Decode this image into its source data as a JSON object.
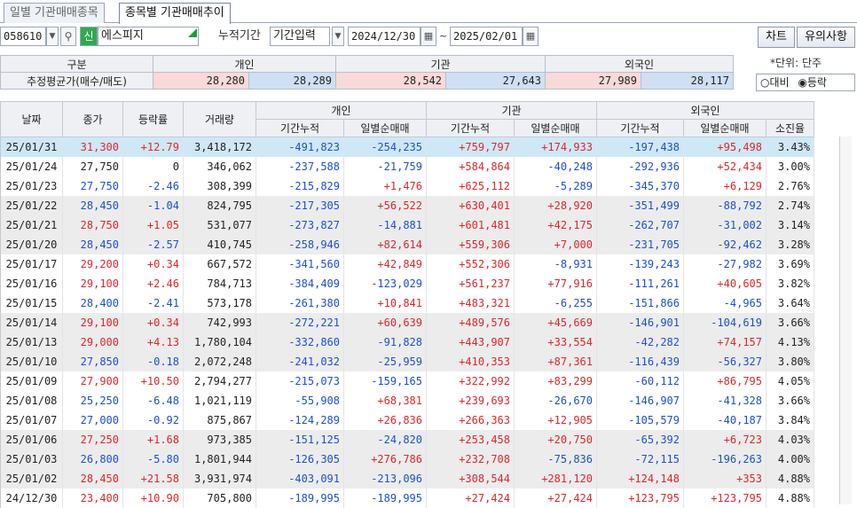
{
  "tabs": [
    {
      "label": "일별 기관매매종목",
      "active": false
    },
    {
      "label": "종목별 기관매매추이",
      "active": true
    }
  ],
  "toolbar": {
    "stock_code": "058610",
    "stock_badge": "신",
    "stock_name": "에스피지",
    "period_label": "누적기간",
    "period_mode": "기간입력",
    "start_date": "2024/12/30",
    "date_sep": "~",
    "end_date": "2025/02/01",
    "chart_button": "차트",
    "notice_button": "유의사항"
  },
  "summary": {
    "row1_label": "구분",
    "row2_label": "추정평균가(매수/매도)",
    "groups": [
      {
        "name": "개인",
        "buy": "28,280",
        "sell": "28,289"
      },
      {
        "name": "기관",
        "buy": "28,542",
        "sell": "27,643"
      },
      {
        "name": "외국인",
        "buy": "27,989",
        "sell": "28,117"
      }
    ],
    "unit": "*단위: 단주",
    "radio_compare": "대비",
    "radio_rate": "등락",
    "selected_radio": "rate"
  },
  "columns": {
    "date": "날짜",
    "close": "종가",
    "change": "등락률",
    "volume": "거래량",
    "individual": "개인",
    "institution": "기관",
    "foreign": "외국인",
    "cum": "기간누적",
    "daily": "일별순매매",
    "exhaust": "소진율"
  },
  "colors": {
    "up": "#e0262b",
    "down": "#1d4fd1",
    "selected_row": "#cfe8f6",
    "gray_row": "#ececec"
  },
  "rows": [
    {
      "date": "25/01/31",
      "close": "31,300",
      "close_dir": "up",
      "change": "+12.79",
      "volume": "3,418,172",
      "ind_cum": "-491,823",
      "ind_day": "-254,235",
      "inst_cum": "+759,797",
      "inst_day": "+174,933",
      "for_cum": "-197,438",
      "for_day": "+95,498",
      "exhaust": "3.43%"
    },
    {
      "date": "25/01/24",
      "close": "27,750",
      "close_dir": "flat",
      "change": "0",
      "volume": "346,062",
      "ind_cum": "-237,588",
      "ind_day": "-21,759",
      "inst_cum": "+584,864",
      "inst_day": "-40,248",
      "for_cum": "-292,936",
      "for_day": "+52,434",
      "exhaust": "3.00%"
    },
    {
      "date": "25/01/23",
      "close": "27,750",
      "close_dir": "dn",
      "change": "-2.46",
      "volume": "308,399",
      "ind_cum": "-215,829",
      "ind_day": "+1,476",
      "inst_cum": "+625,112",
      "inst_day": "-5,289",
      "for_cum": "-345,370",
      "for_day": "+6,129",
      "exhaust": "2.76%"
    },
    {
      "date": "25/01/22",
      "close": "28,450",
      "close_dir": "dn",
      "change": "-1.04",
      "volume": "824,795",
      "ind_cum": "-217,305",
      "ind_day": "+56,522",
      "inst_cum": "+630,401",
      "inst_day": "+28,920",
      "for_cum": "-351,499",
      "for_day": "-88,792",
      "exhaust": "2.74%"
    },
    {
      "date": "25/01/21",
      "close": "28,750",
      "close_dir": "up",
      "change": "+1.05",
      "volume": "531,077",
      "ind_cum": "-273,827",
      "ind_day": "-14,881",
      "inst_cum": "+601,481",
      "inst_day": "+42,175",
      "for_cum": "-262,707",
      "for_day": "-31,002",
      "exhaust": "3.14%"
    },
    {
      "date": "25/01/20",
      "close": "28,450",
      "close_dir": "dn",
      "change": "-2.57",
      "volume": "410,745",
      "ind_cum": "-258,946",
      "ind_day": "+82,614",
      "inst_cum": "+559,306",
      "inst_day": "+7,000",
      "for_cum": "-231,705",
      "for_day": "-92,462",
      "exhaust": "3.28%"
    },
    {
      "date": "25/01/17",
      "close": "29,200",
      "close_dir": "up",
      "change": "+0.34",
      "volume": "667,572",
      "ind_cum": "-341,560",
      "ind_day": "+42,849",
      "inst_cum": "+552,306",
      "inst_day": "-8,931",
      "for_cum": "-139,243",
      "for_day": "-27,982",
      "exhaust": "3.69%"
    },
    {
      "date": "25/01/16",
      "close": "29,100",
      "close_dir": "up",
      "change": "+2.46",
      "volume": "784,713",
      "ind_cum": "-384,409",
      "ind_day": "-123,029",
      "inst_cum": "+561,237",
      "inst_day": "+77,916",
      "for_cum": "-111,261",
      "for_day": "+40,605",
      "exhaust": "3.82%"
    },
    {
      "date": "25/01/15",
      "close": "28,400",
      "close_dir": "dn",
      "change": "-2.41",
      "volume": "573,178",
      "ind_cum": "-261,380",
      "ind_day": "+10,841",
      "inst_cum": "+483,321",
      "inst_day": "-6,255",
      "for_cum": "-151,866",
      "for_day": "-4,965",
      "exhaust": "3.64%"
    },
    {
      "date": "25/01/14",
      "close": "29,100",
      "close_dir": "up",
      "change": "+0.34",
      "volume": "742,993",
      "ind_cum": "-272,221",
      "ind_day": "+60,639",
      "inst_cum": "+489,576",
      "inst_day": "+45,669",
      "for_cum": "-146,901",
      "for_day": "-104,619",
      "exhaust": "3.66%"
    },
    {
      "date": "25/01/13",
      "close": "29,000",
      "close_dir": "up",
      "change": "+4.13",
      "volume": "1,780,104",
      "ind_cum": "-332,860",
      "ind_day": "-91,828",
      "inst_cum": "+443,907",
      "inst_day": "+33,554",
      "for_cum": "-42,282",
      "for_day": "+74,157",
      "exhaust": "4.13%"
    },
    {
      "date": "25/01/10",
      "close": "27,850",
      "close_dir": "dn",
      "change": "-0.18",
      "volume": "2,072,248",
      "ind_cum": "-241,032",
      "ind_day": "-25,959",
      "inst_cum": "+410,353",
      "inst_day": "+87,361",
      "for_cum": "-116,439",
      "for_day": "-56,327",
      "exhaust": "3.80%"
    },
    {
      "date": "25/01/09",
      "close": "27,900",
      "close_dir": "up",
      "change": "+10.50",
      "volume": "2,794,277",
      "ind_cum": "-215,073",
      "ind_day": "-159,165",
      "inst_cum": "+322,992",
      "inst_day": "+83,299",
      "for_cum": "-60,112",
      "for_day": "+86,795",
      "exhaust": "4.05%"
    },
    {
      "date": "25/01/08",
      "close": "25,250",
      "close_dir": "dn",
      "change": "-6.48",
      "volume": "1,021,119",
      "ind_cum": "-55,908",
      "ind_day": "+68,381",
      "inst_cum": "+239,693",
      "inst_day": "-26,670",
      "for_cum": "-146,907",
      "for_day": "-41,328",
      "exhaust": "3.66%"
    },
    {
      "date": "25/01/07",
      "close": "27,000",
      "close_dir": "dn",
      "change": "-0.92",
      "volume": "875,867",
      "ind_cum": "-124,289",
      "ind_day": "+26,836",
      "inst_cum": "+266,363",
      "inst_day": "+12,905",
      "for_cum": "-105,579",
      "for_day": "-40,187",
      "exhaust": "3.84%"
    },
    {
      "date": "25/01/06",
      "close": "27,250",
      "close_dir": "up",
      "change": "+1.68",
      "volume": "973,385",
      "ind_cum": "-151,125",
      "ind_day": "-24,820",
      "inst_cum": "+253,458",
      "inst_day": "+20,750",
      "for_cum": "-65,392",
      "for_day": "+6,723",
      "exhaust": "4.03%"
    },
    {
      "date": "25/01/03",
      "close": "26,800",
      "close_dir": "dn",
      "change": "-5.80",
      "volume": "1,801,944",
      "ind_cum": "-126,305",
      "ind_day": "+276,786",
      "inst_cum": "+232,708",
      "inst_day": "-75,836",
      "for_cum": "-72,115",
      "for_day": "-196,263",
      "exhaust": "4.00%"
    },
    {
      "date": "25/01/02",
      "close": "28,450",
      "close_dir": "up",
      "change": "+21.58",
      "volume": "3,931,974",
      "ind_cum": "-403,091",
      "ind_day": "-213,096",
      "inst_cum": "+308,544",
      "inst_day": "+281,120",
      "for_cum": "+124,148",
      "for_day": "+353",
      "exhaust": "4.88%"
    },
    {
      "date": "24/12/30",
      "close": "23,400",
      "close_dir": "up",
      "change": "+10.90",
      "volume": "705,800",
      "ind_cum": "-189,995",
      "ind_day": "-189,995",
      "inst_cum": "+27,424",
      "inst_day": "+27,424",
      "for_cum": "+123,795",
      "for_day": "+123,795",
      "exhaust": "4.88%"
    }
  ]
}
